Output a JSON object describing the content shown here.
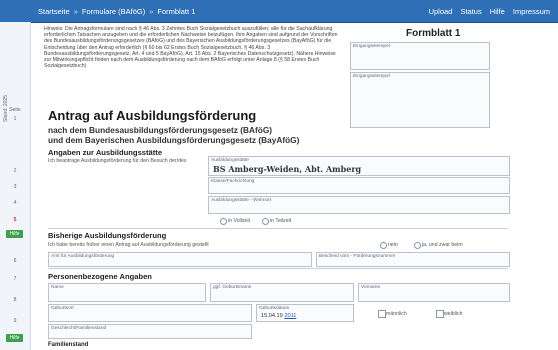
{
  "nav": {
    "crumbs": [
      "Startseite",
      "Formulare (BAföG)",
      "Formblatt 1"
    ],
    "links": [
      "Upload",
      "Status",
      "Hilfe",
      "Impressum"
    ]
  },
  "gutter": {
    "vertical": "Stand: 2025",
    "lines": [
      "Seite",
      "1",
      "2",
      "3",
      "4",
      "5",
      "6",
      "7",
      "8",
      "9",
      "10"
    ],
    "green1": "Hilfe",
    "green2": "Hilfe"
  },
  "form": {
    "intro": "Hinweis: Die Antragsformulare sind nach § 46 Abs. 3 Zehntes Buch Sozialgesetzbuch auszufüllen; alle für die Sachaufklärung erforderlichen Tatsachen anzugeben und die erforderlichen Nachweise beizufügen. Ihre Angaben sind aufgrund der Vorschriften des Bundesausbildungsförderungsgesetzes (BAföG) und des Bayerischen Ausbildungsförderungsgesetzes (BayAföG) für die Entscheidung über den Antrag erforderlich (§ 60 bis 62 Erstes Buch Sozialgesetzbuch, § 46 Abs. 3 Bundesausbildungsförderungsgesetz, Art. 4 und 5 BayAföG). Art. 15 Abs. 2 Bayerisches Datenschutzgesetz). Nähere Hinweise zur Mitwirkungspflicht finden nach dem Ausbildungsförderung nach dem BAföG erfolgt unter Anlage 8 (§ 58 Erstes Buch Sozialgesetzbuch)",
    "title": "Formblatt 1",
    "box_receipt_label": "Eingangsstempel",
    "box_receipt2_label": "Eingangsstempel",
    "heading": "Antrag auf Ausbildungsförderung",
    "subheading1": "nach dem Bundesausbildungsförderungsgesetz (BAföG)",
    "subheading2": "und dem Bayerischen Ausbildungsförderungsgesetz (BayAföG)",
    "section_office": "Angaben zur Ausbildungsstätte",
    "office_hint": "Ich beantrage Ausbildungsförderung für den Besuch der/des",
    "office_label": "Ausbildungsstätte",
    "office_value": "BS Amberg-Weiden, Abt. Amberg",
    "class_label": "Klasse/Fachrichtung",
    "start_label": "Ausbildungsstätte - Wohnort",
    "opt_fulltime": "in Vollzeit",
    "opt_parttime": "in Teilzeit",
    "section_prev": "Bisherige Ausbildungsförderung",
    "prev_question": "Ich habe bereits früher einen Antrag auf Ausbildungsförderung gestellt",
    "prev_no": "nein",
    "prev_yes": "ja, und zwar beim",
    "prev_field1": "Amt für Ausbildungsförderung",
    "prev_field2": "Bescheid vom - Förderungsnummer",
    "section_person": "Personenbezogene Angaben",
    "name_label": "Name",
    "firstname_label": "ggf. Geburtsname",
    "birthname_label": "Vorname",
    "birthplace_label": "Geburtsort",
    "birthdate_label": "Geburtsdatum",
    "birthdate_value": "15.04.19 ",
    "birthdate_year": "2011",
    "sex_label": "Geschlecht/Familienstand",
    "single": "männlich",
    "married": "weiblich",
    "section_addr": "Familienstand"
  }
}
